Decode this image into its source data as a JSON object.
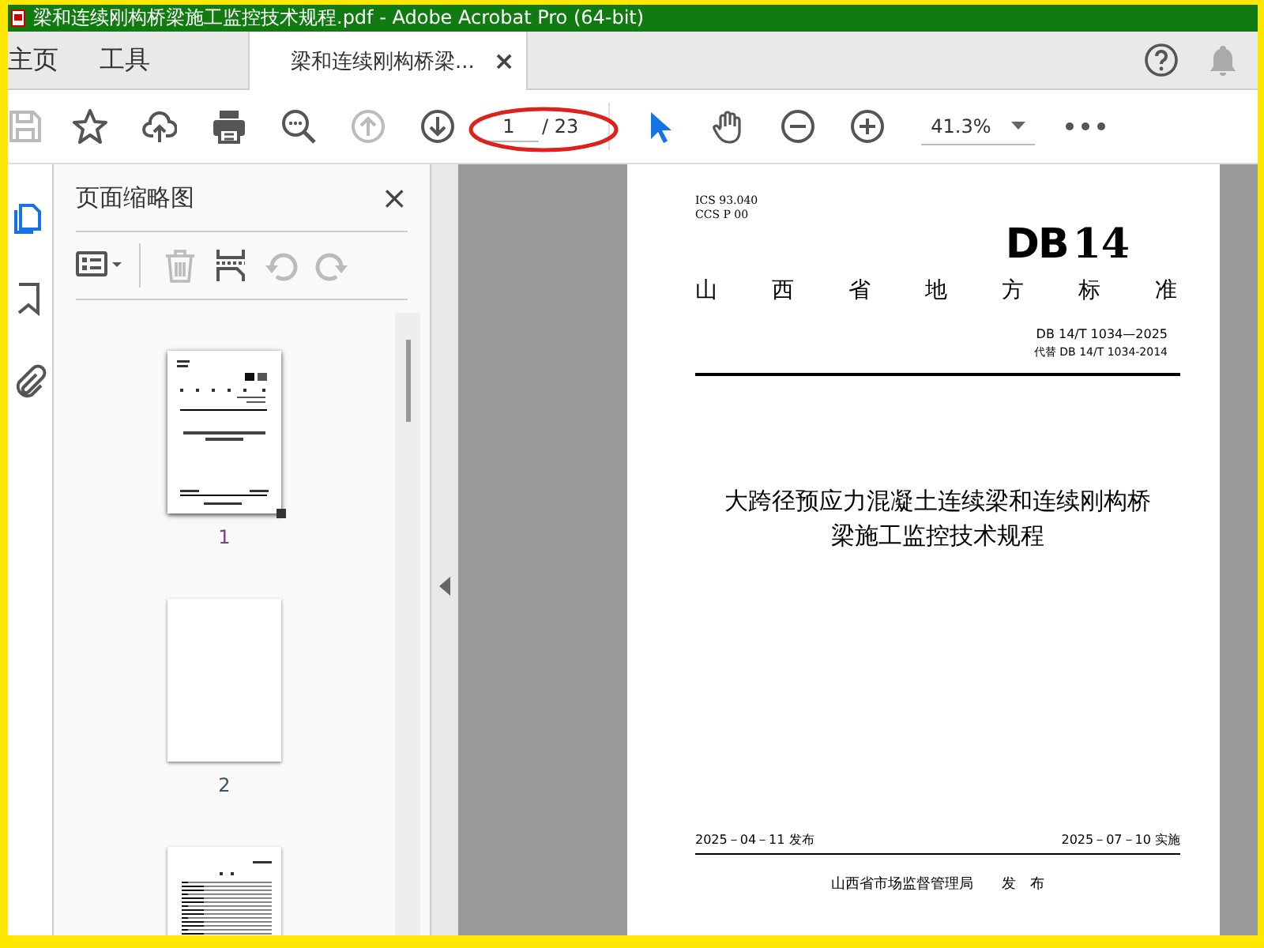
{
  "window": {
    "title": "梁和连续刚构桥梁施工监控技术规程.pdf - Adobe Acrobat Pro (64-bit)"
  },
  "tabs": [
    {
      "label": "主页",
      "kind": "nav",
      "selected": false
    },
    {
      "label": "工具",
      "kind": "nav",
      "selected": false
    },
    {
      "label": "梁和连续刚构桥梁...",
      "kind": "document",
      "selected": true,
      "close": "×"
    }
  ],
  "toolbar": {
    "nav_tools": [
      {
        "kind": "save",
        "disabled": true
      },
      {
        "kind": "bookmark",
        "disabled": false
      },
      {
        "kind": "upload",
        "disabled": false
      },
      {
        "kind": "print",
        "disabled": false
      },
      {
        "kind": "search",
        "disabled": false
      },
      {
        "kind": "up",
        "disabled": true
      },
      {
        "kind": "down",
        "disabled": false
      }
    ],
    "page_field": {
      "value": "1",
      "total": "/ 23"
    },
    "view_tools": [
      {
        "kind": "select",
        "selected": true
      },
      {
        "kind": "hand",
        "selected": false
      },
      {
        "kind": "zoom_out",
        "selected": false
      },
      {
        "kind": "zoom_in",
        "selected": false
      }
    ],
    "zoom": {
      "value": "41.3%"
    }
  },
  "side_rail": [
    {
      "kind": "pages",
      "selected": true
    },
    {
      "kind": "bookmarks",
      "selected": false
    },
    {
      "kind": "attachments",
      "selected": false
    }
  ],
  "thumbnail_panel": {
    "title": "页面缩略图",
    "close": "×",
    "tools": [
      {
        "kind": "options",
        "disabled": false
      },
      {
        "kind": "delete",
        "disabled": true
      },
      {
        "kind": "extract",
        "disabled": false
      },
      {
        "kind": "rotate_left",
        "disabled": true
      },
      {
        "kind": "rotate_right",
        "disabled": true
      }
    ],
    "thumbnails": [
      {
        "kind": "cover",
        "label": "1",
        "selected": true
      },
      {
        "kind": "blank",
        "label": "2",
        "selected": false
      },
      {
        "kind": "contents",
        "selected": false
      }
    ]
  },
  "document": {
    "ics": "ICS 93.040",
    "ccs": "CCS P 00",
    "logo_code": "DB",
    "logo_number": "14",
    "category": "山西省地方标准",
    "number": "DB 14/T 1034—2025",
    "replaces": "代替 DB 14/T 1034-2014",
    "title_lines": [
      "大跨径预应力混凝土连续梁和连续刚构桥",
      "梁施工监控技术规程"
    ],
    "issue_date": "2025－04－11 发布",
    "effective_date": "2025－07－10 实施",
    "issuer": "山西省市场监督管理局　　发　布"
  }
}
